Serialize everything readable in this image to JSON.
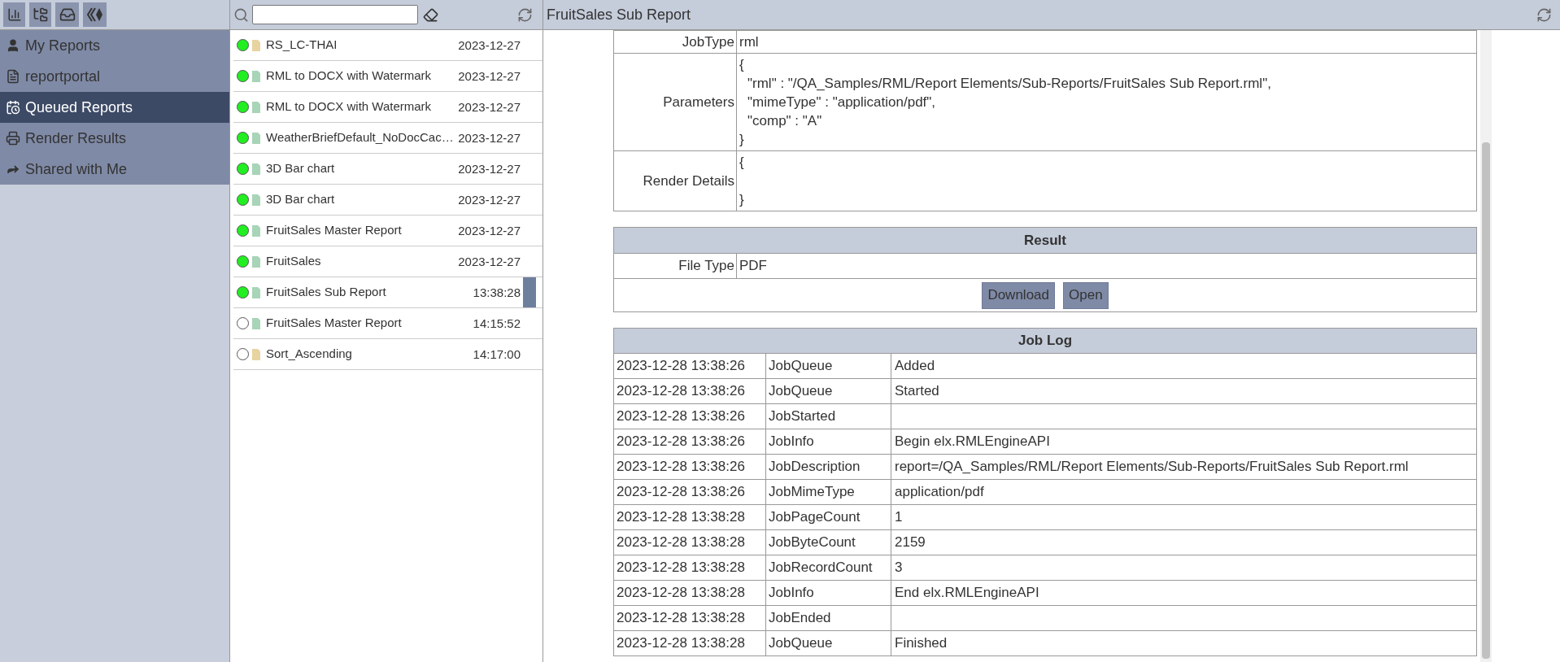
{
  "nav": [
    {
      "label": "My Reports",
      "selected": false
    },
    {
      "label": "reportportal",
      "selected": false
    },
    {
      "label": "Queued Reports",
      "selected": true
    },
    {
      "label": "Render Results",
      "selected": false
    },
    {
      "label": "Shared with Me",
      "selected": false
    }
  ],
  "reports": [
    {
      "name": "RS_LC-THAI",
      "time": "2023-12-27",
      "complete": true,
      "color": "#e8d4a0",
      "selected": false
    },
    {
      "name": "RML to DOCX with Watermark",
      "time": "2023-12-27",
      "complete": true,
      "color": "#a8d4b8",
      "selected": false
    },
    {
      "name": "RML to DOCX with Watermark",
      "time": "2023-12-27",
      "complete": true,
      "color": "#a8d4b8",
      "selected": false
    },
    {
      "name": "WeatherBriefDefault_NoDocCac…",
      "time": "2023-12-27",
      "complete": true,
      "color": "#a8d4b8",
      "selected": false
    },
    {
      "name": "3D Bar chart",
      "time": "2023-12-27",
      "complete": true,
      "color": "#a8d4b8",
      "selected": false
    },
    {
      "name": "3D Bar chart",
      "time": "2023-12-27",
      "complete": true,
      "color": "#a8d4b8",
      "selected": false
    },
    {
      "name": "FruitSales Master Report",
      "time": "2023-12-27",
      "complete": true,
      "color": "#a8d4b8",
      "selected": false
    },
    {
      "name": "FruitSales",
      "time": "2023-12-27",
      "complete": true,
      "color": "#a8d4b8",
      "selected": false
    },
    {
      "name": "FruitSales Sub Report",
      "time": "13:38:28",
      "complete": true,
      "color": "#a8d4b8",
      "selected": true
    },
    {
      "name": "FruitSales Master Report",
      "time": "14:15:52",
      "complete": false,
      "color": "#a8d4b8",
      "selected": false
    },
    {
      "name": "Sort_Ascending",
      "time": "14:17:00",
      "complete": false,
      "color": "#e8d4a0",
      "selected": false
    }
  ],
  "detail": {
    "title": "FruitSales Sub Report",
    "fields": [
      {
        "label": "JobType",
        "lines": [
          "rml"
        ]
      },
      {
        "label": "Parameters",
        "lines": [
          "{",
          "\"rml\" : \"/QA_Samples/RML/Report Elements/Sub-Reports/FruitSales Sub Report.rml\",",
          "\"mimeType\" : \"application/pdf\",",
          "\"comp\" : \"A\"",
          "}"
        ]
      },
      {
        "label": "Render Details",
        "lines": [
          "{",
          "}"
        ]
      }
    ],
    "result": {
      "title": "Result",
      "fields": [
        {
          "label": "File Type",
          "value": "PDF"
        }
      ],
      "buttons": [
        "Download",
        "Open"
      ]
    },
    "job_log": {
      "title": "Job Log",
      "rows": [
        {
          "time": "2023-12-28 13:38:26",
          "event": "JobQueue",
          "message": "Added"
        },
        {
          "time": "2023-12-28 13:38:26",
          "event": "JobQueue",
          "message": "Started"
        },
        {
          "time": "2023-12-28 13:38:26",
          "event": "JobStarted"
        },
        {
          "time": "2023-12-28 13:38:26",
          "event": "JobInfo",
          "message": "Begin elx.RMLEngineAPI"
        },
        {
          "time": "2023-12-28 13:38:26",
          "event": "JobDescription",
          "message": "report=/QA_Samples/RML/Report Elements/Sub-Reports/FruitSales Sub Report.rml"
        },
        {
          "time": "2023-12-28 13:38:26",
          "event": "JobMimeType",
          "message": "application/pdf"
        },
        {
          "time": "2023-12-28 13:38:28",
          "event": "JobPageCount",
          "message": "1"
        },
        {
          "time": "2023-12-28 13:38:28",
          "event": "JobByteCount",
          "message": "2159"
        },
        {
          "time": "2023-12-28 13:38:28",
          "event": "JobRecordCount",
          "message": "3"
        },
        {
          "time": "2023-12-28 13:38:28",
          "event": "JobInfo",
          "message": "End elx.RMLEngineAPI"
        },
        {
          "time": "2023-12-28 13:38:28",
          "event": "JobEnded"
        },
        {
          "time": "2023-12-28 13:38:28",
          "event": "JobQueue",
          "message": "Finished"
        }
      ]
    }
  }
}
